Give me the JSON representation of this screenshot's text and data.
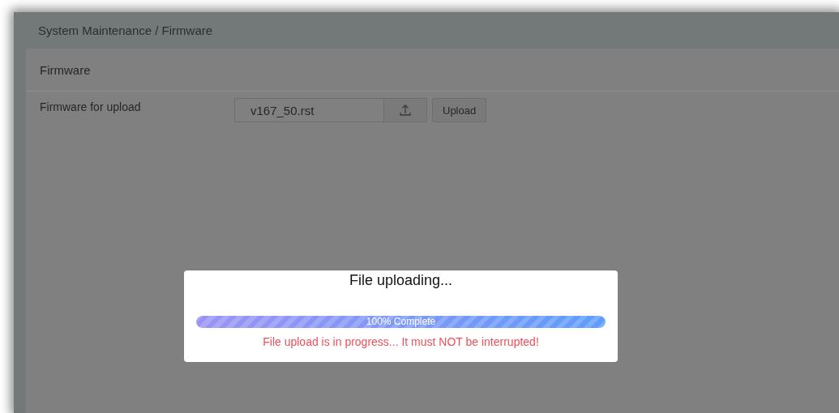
{
  "breadcrumb": "System Maintenance / Firmware",
  "panel": {
    "title": "Firmware",
    "field_label": "Firmware for upload",
    "file_value": "v167_50.rst",
    "upload_button": "Upload"
  },
  "dialog": {
    "title": "File uploading...",
    "progress": {
      "level": 1,
      "label": "100% Complete"
    },
    "warning": "File upload is in progress... It must NOT be interrupted!"
  }
}
